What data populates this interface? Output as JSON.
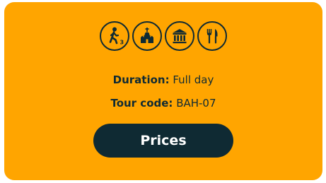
{
  "activity_icons": [
    {
      "icon": "hiking-difficulty-icon",
      "badge": "3"
    },
    {
      "icon": "church-icon"
    },
    {
      "icon": "museum-icon"
    },
    {
      "icon": "restaurant-icon"
    }
  ],
  "details": {
    "duration_label": "Duration:",
    "duration_value": "Full day",
    "tour_code_label": "Tour code:",
    "tour_code_value": "BAH-07"
  },
  "prices_button": {
    "label": "Prices"
  },
  "colors": {
    "card_background": "#ffa500",
    "dark": "#0f2a33",
    "button_text": "#ffffff"
  }
}
